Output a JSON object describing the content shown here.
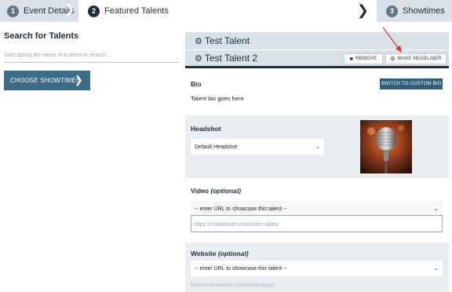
{
  "stepper": {
    "steps": [
      {
        "number": "1",
        "label": "Event Details"
      },
      {
        "number": "2",
        "label": "Featured Talents"
      },
      {
        "number": "3",
        "label": "Showtimes"
      }
    ]
  },
  "search": {
    "title": "Search for Talents",
    "placeholder": "Start typing the name of a talent to search...",
    "choose_button": "CHOOSE SHOWTIMES"
  },
  "talents": [
    {
      "name": "Test Talent"
    },
    {
      "name": "Test Talent 2",
      "remove_label": "REMOVE",
      "headliner_label": "MAKE HEADLINER"
    }
  ],
  "bio": {
    "label": "Bio",
    "custom_button": "SWITCH TO CUSTOM BIO",
    "text": "Talent bio goes here."
  },
  "headshot": {
    "label": "Headshot",
    "selected": "Default Headshot",
    "image_subject": "microphone"
  },
  "video": {
    "label": "Video",
    "optional": "(optional)",
    "select_value": "-- enter URL to showcase this talent --",
    "placeholder": "https://mywebsite.com/some-video"
  },
  "website": {
    "label": "Website",
    "optional": "(optional)",
    "select_value": "-- enter URL to showcase this talent --",
    "url_hint": "https://mywebsite.com/some-page"
  },
  "colors": {
    "accent": "#3b6b86",
    "dark": "#1f2d3a",
    "annotation": "#e0312b"
  }
}
